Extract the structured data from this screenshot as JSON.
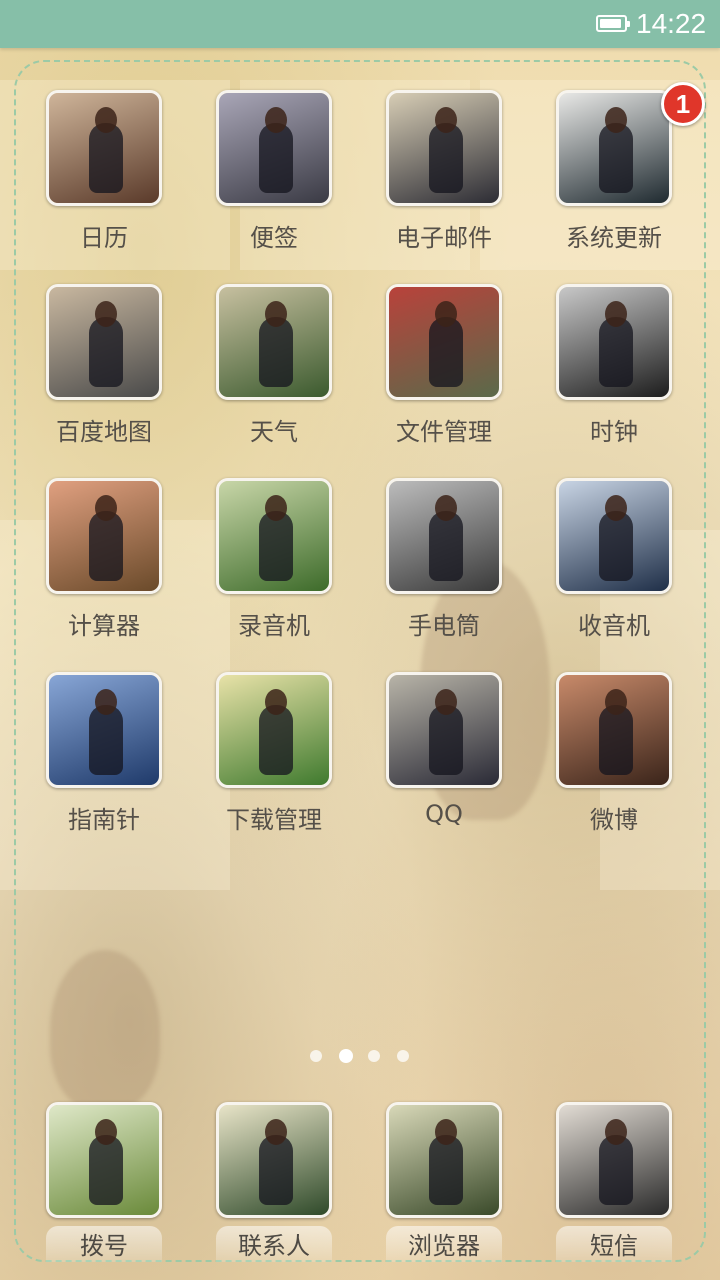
{
  "status_bar": {
    "time": "14:22",
    "icons": [
      "battery-icon"
    ]
  },
  "home": {
    "pages_total": 4,
    "active_page": 2,
    "apps": [
      {
        "label": "日历",
        "photo": [
          "#5a3a2a",
          "#cfb59a"
        ]
      },
      {
        "label": "便签",
        "photo": [
          "#3a3a44",
          "#a9a6b7"
        ]
      },
      {
        "label": "电子邮件",
        "photo": [
          "#2c2c34",
          "#d7cdb5"
        ]
      },
      {
        "label": "系统更新",
        "photo": [
          "#1f2a30",
          "#e8e8e6"
        ],
        "badge": "1"
      },
      {
        "label": "百度地图",
        "photo": [
          "#4a4a4a",
          "#c9b8a0"
        ]
      },
      {
        "label": "天气",
        "photo": [
          "#3b5a2e",
          "#c7c0a0"
        ]
      },
      {
        "label": "文件管理",
        "photo": [
          "#5a6a4a",
          "#b9423b"
        ]
      },
      {
        "label": "时钟",
        "photo": [
          "#1d1d1d",
          "#c8c8c8"
        ]
      },
      {
        "label": "计算器",
        "photo": [
          "#6a4a2a",
          "#e0a080"
        ]
      },
      {
        "label": "录音机",
        "photo": [
          "#3d6b2a",
          "#c8d6a8"
        ]
      },
      {
        "label": "手电筒",
        "photo": [
          "#3a3a3a",
          "#bcbcbc"
        ]
      },
      {
        "label": "收音机",
        "photo": [
          "#1f2f48",
          "#c8d4e4"
        ]
      },
      {
        "label": "指南针",
        "photo": [
          "#1f3a6a",
          "#88a6d6"
        ]
      },
      {
        "label": "下载管理",
        "photo": [
          "#3f7a2e",
          "#e8e2a8"
        ]
      },
      {
        "label": "QQ",
        "photo": [
          "#2a2a36",
          "#b8b4a8"
        ]
      },
      {
        "label": "微博",
        "photo": [
          "#3a241a",
          "#c88a6a"
        ]
      }
    ]
  },
  "dock": {
    "apps": [
      {
        "label": "拨号",
        "photo": [
          "#6a8a3a",
          "#dfe8c8"
        ]
      },
      {
        "label": "联系人",
        "photo": [
          "#2f4a2a",
          "#e8e4c8"
        ]
      },
      {
        "label": "浏览器",
        "photo": [
          "#3a4a2a",
          "#d8d8b8"
        ]
      },
      {
        "label": "短信",
        "photo": [
          "#2a2a2a",
          "#e2dcd4"
        ]
      }
    ]
  }
}
